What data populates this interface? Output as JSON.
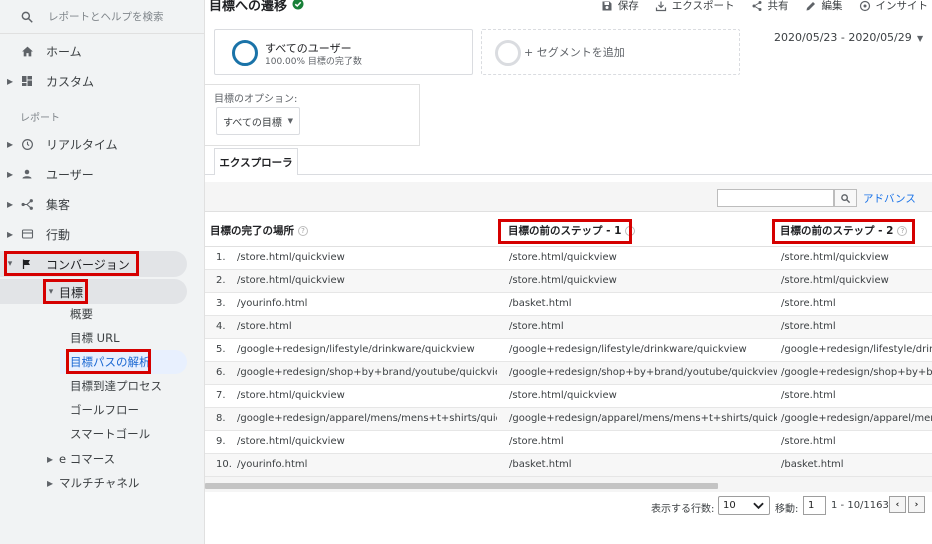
{
  "sidebar": {
    "search_placeholder": "レポートとヘルプを検索",
    "home": "ホーム",
    "custom": "カスタム",
    "reports_section": "レポート",
    "realtime": "リアルタイム",
    "users": "ユーザー",
    "acquisition": "集客",
    "behavior": "行動",
    "conversions": "コンバージョン",
    "goals": "目標",
    "goal_items": [
      "概要",
      "目標 URL",
      "目標パスの解析",
      "目標到達プロセス",
      "ゴールフロー",
      "スマートゴール"
    ],
    "ecommerce": "e コマース",
    "multichannel": "マルチチャネル"
  },
  "header": {
    "title": "目標への遷移",
    "save": "保存",
    "export": "エクスポート",
    "share": "共有",
    "edit": "編集",
    "insights": "インサイト"
  },
  "segments": {
    "all_users": "すべてのユーザー",
    "all_users_sub": "100.00% 目標の完了数",
    "add_segment": "+ セグメントを追加"
  },
  "date_range": "2020/05/23 - 2020/05/29",
  "goal_options": {
    "label": "目標のオプション:",
    "selected": "すべての目標"
  },
  "tab_explorer": "エクスプローラ",
  "advanced_link": "アドバンス",
  "table": {
    "headers": [
      "目標の完了の場所",
      "目標の前のステップ - 1",
      "目標の前のステップ - 2"
    ],
    "rows": [
      {
        "n": "1.",
        "c1": "/store.html/quickview",
        "c2": "/store.html/quickview",
        "c3": "/store.html/quickview"
      },
      {
        "n": "2.",
        "c1": "/store.html/quickview",
        "c2": "/store.html/quickview",
        "c3": "/store.html/quickview"
      },
      {
        "n": "3.",
        "c1": "/yourinfo.html",
        "c2": "/basket.html",
        "c3": "/store.html"
      },
      {
        "n": "4.",
        "c1": "/store.html",
        "c2": "/store.html",
        "c3": "/store.html"
      },
      {
        "n": "5.",
        "c1": "/google+redesign/lifestyle/drinkware/quickview",
        "c2": "/google+redesign/lifestyle/drinkware/quickview",
        "c3": "/google+redesign/lifestyle/drinkware/quickview"
      },
      {
        "n": "6.",
        "c1": "/google+redesign/shop+by+brand/youtube/quickview",
        "c2": "/google+redesign/shop+by+brand/youtube/quickview",
        "c3": "/google+redesign/shop+by+brand/youtube/quickview"
      },
      {
        "n": "7.",
        "c1": "/store.html/quickview",
        "c2": "/store.html/quickview",
        "c3": "/store.html"
      },
      {
        "n": "8.",
        "c1": "/google+redesign/apparel/mens/mens+t+shirts/quickview",
        "c2": "/google+redesign/apparel/mens/mens+t+shirts/quickview",
        "c3": "/google+redesign/apparel/mens/mens+t+shirts/quickview"
      },
      {
        "n": "9.",
        "c1": "/store.html/quickview",
        "c2": "/store.html",
        "c3": "/store.html"
      },
      {
        "n": "10.",
        "c1": "/yourinfo.html",
        "c2": "/basket.html",
        "c3": "/basket.html"
      }
    ]
  },
  "pager": {
    "rows_label": "表示する行数:",
    "rows_value": "10",
    "goto_label": "移動:",
    "goto_value": "1",
    "range": "1 - 10/1163"
  },
  "colors": {
    "highlight_red": "#d50000",
    "link_blue": "#1a73e8",
    "active_item_bg": "#e8f0fe"
  }
}
